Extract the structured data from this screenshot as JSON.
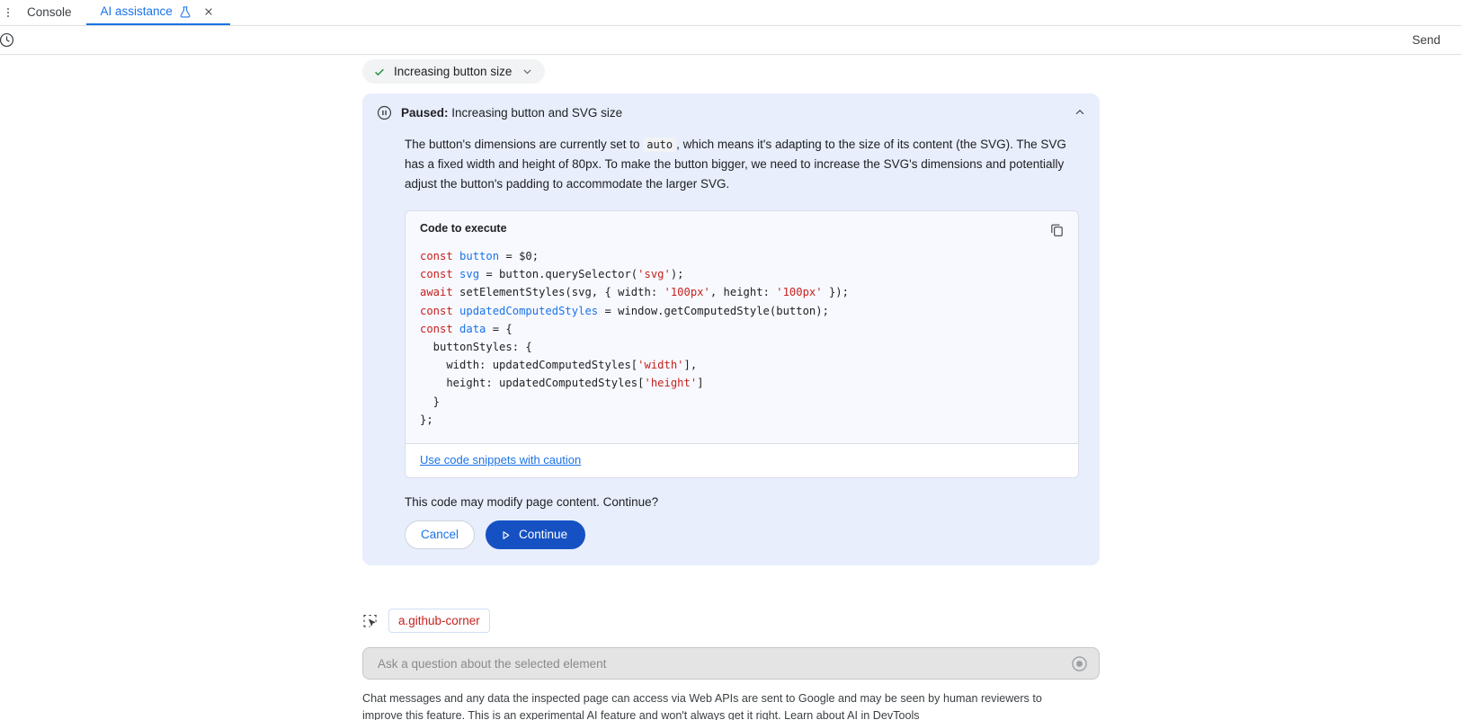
{
  "tabs": {
    "items": [
      {
        "label": "Console",
        "active": false,
        "icon": null
      },
      {
        "label": "AI assistance",
        "active": true,
        "icon": "flask-icon"
      }
    ],
    "close_label": "×"
  },
  "toolbar": {
    "history_icon": "history-icon",
    "send_label": "Send"
  },
  "conversation": {
    "step": {
      "label": "Increasing button size",
      "status_icon": "check-icon",
      "expand_icon": "chevron-down-icon"
    },
    "panel": {
      "icon": "pause-icon",
      "title_prefix": "Paused:",
      "title": "Increasing button and SVG size",
      "collapse_icon": "chevron-up-icon",
      "body_part1": "The button's dimensions are currently set to",
      "body_code": "auto",
      "body_part2": ", which means it's adapting to the size of its content (the SVG). The SVG has a fixed width and height of 80px. To make the button bigger, we need to increase the SVG's dimensions and potentially adjust the button's padding to accommodate the larger SVG.",
      "code_card": {
        "title": "Code to execute",
        "copy_icon": "copy-icon",
        "footer_link": "Use code snippets with caution",
        "lines": [
          [
            {
              "t": "const ",
              "c": "kw"
            },
            {
              "t": "button",
              "c": "var"
            },
            {
              "t": " = $0;",
              "c": "plain"
            }
          ],
          [
            {
              "t": "const ",
              "c": "kw"
            },
            {
              "t": "svg",
              "c": "var"
            },
            {
              "t": " = button.querySelector(",
              "c": "plain"
            },
            {
              "t": "'svg'",
              "c": "str"
            },
            {
              "t": ");",
              "c": "plain"
            }
          ],
          [
            {
              "t": "await ",
              "c": "kw"
            },
            {
              "t": "setElementStyles(svg, { width: ",
              "c": "plain"
            },
            {
              "t": "'100px'",
              "c": "str"
            },
            {
              "t": ", height: ",
              "c": "plain"
            },
            {
              "t": "'100px'",
              "c": "str"
            },
            {
              "t": " });",
              "c": "plain"
            }
          ],
          [
            {
              "t": "const ",
              "c": "kw"
            },
            {
              "t": "updatedComputedStyles",
              "c": "var"
            },
            {
              "t": " = window.getComputedStyle(button);",
              "c": "plain"
            }
          ],
          [
            {
              "t": "const ",
              "c": "kw"
            },
            {
              "t": "data",
              "c": "var"
            },
            {
              "t": " = {",
              "c": "plain"
            }
          ],
          [
            {
              "t": "  buttonStyles: {",
              "c": "plain"
            }
          ],
          [
            {
              "t": "    width: updatedComputedStyles[",
              "c": "plain"
            },
            {
              "t": "'width'",
              "c": "str"
            },
            {
              "t": "],",
              "c": "plain"
            }
          ],
          [
            {
              "t": "    height: updatedComputedStyles[",
              "c": "plain"
            },
            {
              "t": "'height'",
              "c": "str"
            },
            {
              "t": "]",
              "c": "plain"
            }
          ],
          [
            {
              "t": "  }",
              "c": "plain"
            }
          ],
          [
            {
              "t": "};",
              "c": "plain"
            }
          ]
        ]
      },
      "confirm_text": "This code may modify page content. Continue?",
      "cancel_label": "Cancel",
      "continue_label": "Continue",
      "continue_icon": "play-icon"
    }
  },
  "selection": {
    "picker_icon": "element-picker-icon",
    "selector": "a.github-corner"
  },
  "input": {
    "placeholder": "Ask a question about the selected element",
    "value": "",
    "stop_icon": "stop-recording-icon"
  },
  "disclaimer": {
    "text": "Chat messages and any data the inspected page can access via Web APIs are sent to Google and may be seen by human reviewers to improve this feature. This is an experimental AI feature and won't always get it right. ",
    "link": "Learn about AI in DevTools"
  },
  "colors": {
    "accent": "#1a73e8",
    "panel_bg": "#e8eefc",
    "success": "#1e8e3e",
    "selector_text": "#c5221f",
    "continue_bg": "#1651c4"
  }
}
